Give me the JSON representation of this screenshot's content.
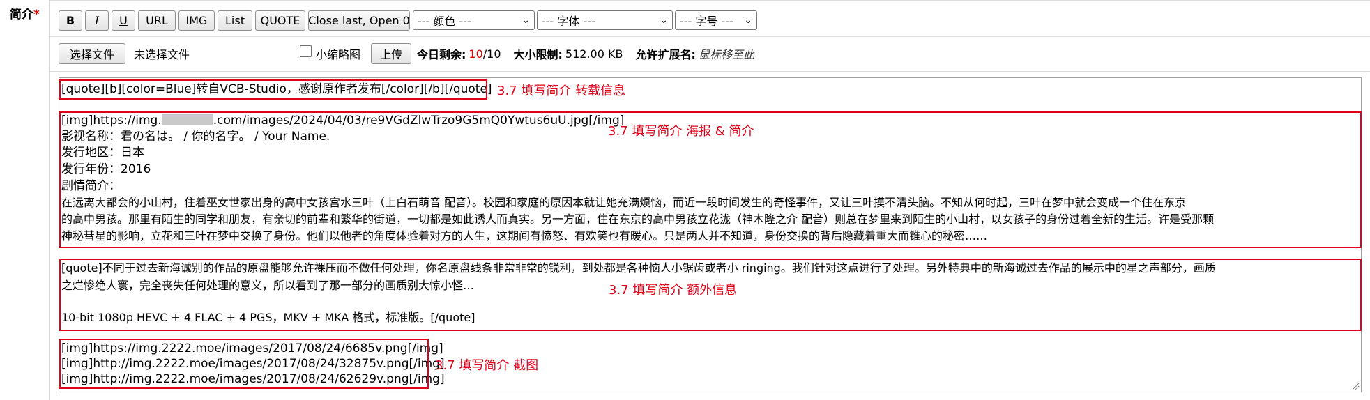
{
  "field": {
    "label": "简介",
    "required_mark": "*"
  },
  "toolbar": {
    "bold": "B",
    "italic": "I",
    "underline": "U",
    "url": "URL",
    "img": "IMG",
    "list": "List",
    "quote": "QUOTE",
    "close_last": "Close last, Open 0",
    "color_select": "--- 颜色 ---",
    "font_select": "--- 字体 ---",
    "size_select": "--- 字号 ---"
  },
  "upload": {
    "choose_file": "选择文件",
    "no_file": "未选择文件",
    "thumbnail_label": "小缩略图",
    "upload_button": "上传",
    "today_remaining_label": "今日剩余:",
    "today_remaining_used": "10",
    "today_remaining_total": "/10",
    "size_limit_label": "大小限制:",
    "size_limit_value": "512.00 KB",
    "allowed_ext_label": "允许扩展名:",
    "allowed_ext_value": "鼠标移至此"
  },
  "content": {
    "quote_line": "[quote][b][color=Blue]转自VCB-Studio，感谢原作者发布[/color][/b][/quote]",
    "img_prefix": "[img]https://img.",
    "img_suffix": ".com/images/2024/04/03/re9VGdZlwTrzo9G5mQ0Ywtus6uU.jpg[/img]",
    "info": [
      "影视名称：君の名は。 / 你的名字。 / Your Name.",
      "发行地区：日本",
      "发行年份：2016",
      "剧情简介："
    ],
    "synopsis": [
      "      在远离大都会的小山村，住着巫女世家出身的高中女孩宫水三叶（上白石萌音 配音）。校园和家庭的原因本就让她充满烦恼，而近一段时间发生的奇怪事件，又让三叶摸不清头脑。不知从何时起，三叶在梦中就会变成一个住在东京",
      "的高中男孩。那里有陌生的同学和朋友，有亲切的前辈和繁华的街道，一切都是如此诱人而真实。另一方面，住在东京的高中男孩立花泷（神木隆之介 配音）则总在梦里来到陌生的小山村，以女孩子的身份过着全新的生活。许是受那颗",
      "神秘彗星的影响，立花和三叶在梦中交换了身份。他们以他者的角度体验着对方的人生，这期间有愤怒、有欢笑也有暖心。只是两人并不知道，身份交换的背后隐藏着重大而锥心的秘密……"
    ],
    "extra": [
      "[quote]不同于过去新海诚别的作品的原盘能够允许裸压而不做任何处理，你名原盘线条非常非常的锐利，到处都是各种恼人小锯齿或者小 ringing。我们针对这点进行了处理。另外特典中的新海诚过去作品的展示中的星之声部分，画质",
      "之烂惨绝人寰，完全丧失任何处理的意义，所以看到了那一部分的画质别大惊小怪…",
      "10-bit 1080p HEVC + 4 FLAC + 4 PGS，MKV + MKA 格式，标准版。[/quote]"
    ],
    "screenshots": [
      "[img]https://img.2222.moe/images/2017/08/24/6685v.png[/img]",
      "[img]http://img.2222.moe/images/2017/08/24/32875v.png[/img]",
      "[img]http://img.2222.moe/images/2017/08/24/62629v.png[/img]"
    ]
  },
  "annotations": {
    "a1": "3.7 填写简介 转载信息",
    "a2": "3.7 填写简介 海报 & 简介",
    "a3": "3.7 填写简介 额外信息",
    "a4": "3.7 填写简介 截图"
  },
  "colors": {
    "annotation_red": "#e0001a",
    "required_red": "#e00000"
  }
}
